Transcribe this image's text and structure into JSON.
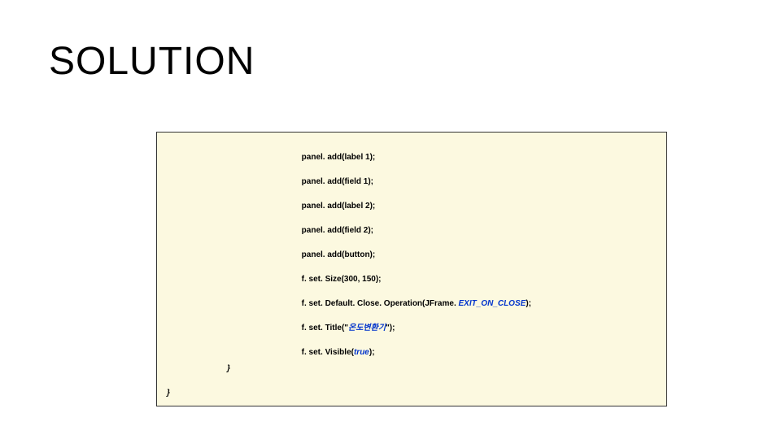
{
  "title": "SOLUTION",
  "code": {
    "l1a": "panel. add(label 1);",
    "l2a": "panel. add(field 1);",
    "l3a": "panel. add(label 2);",
    "l4a": "panel. add(field 2);",
    "l5a": "panel. add(button);",
    "l6a": "f. set. Size(300, 150);",
    "l7a": "f. set. Default. Close. Operation(JFrame. ",
    "l7b": "EXIT_ON_CLOSE",
    "l7c": ");",
    "l8a": "f. set. Title(\"",
    "l8b": "온도변환기",
    "l8c": "\");",
    "l9a": "f. set. Visible(",
    "l9b": "true",
    "l9c": ");",
    "brace1": "}",
    "brace2": "}"
  }
}
